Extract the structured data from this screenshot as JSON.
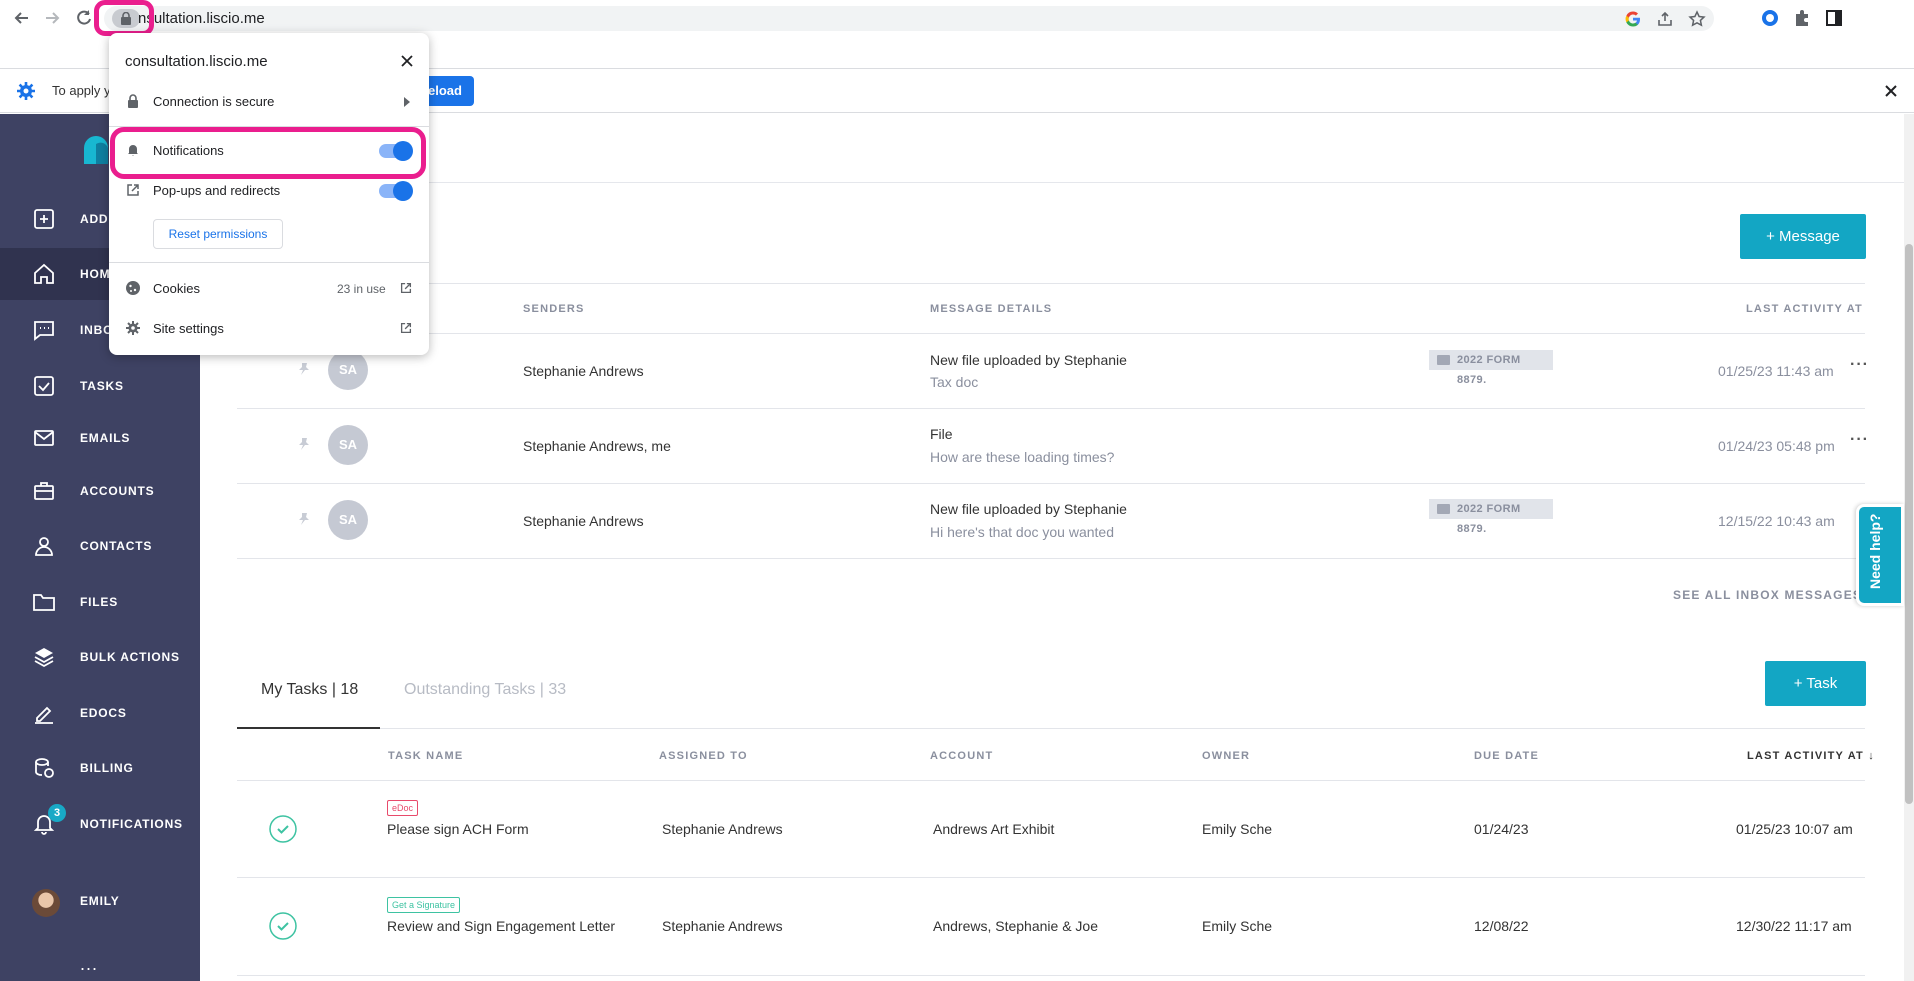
{
  "browser": {
    "url": "consultation.liscio.me",
    "url_visible": "nsultation.liscio.me"
  },
  "infobar": {
    "text": "To apply y",
    "reload_label": "eload"
  },
  "site_popup": {
    "domain": "consultation.liscio.me",
    "connection": "Connection is secure",
    "notifications": "Notifications",
    "notifications_on": true,
    "popups": "Pop-ups and redirects",
    "popups_on": true,
    "reset": "Reset permissions",
    "cookies": "Cookies",
    "cookies_count": "23 in use",
    "site_settings": "Site settings"
  },
  "sidebar": {
    "items": [
      {
        "label": "ADD",
        "icon": "plus-square-icon"
      },
      {
        "label": "HOME",
        "icon": "home-icon"
      },
      {
        "label": "INBOX",
        "icon": "chat-icon"
      },
      {
        "label": "TASKS",
        "icon": "checkbox-icon"
      },
      {
        "label": "EMAILS",
        "icon": "mail-icon"
      },
      {
        "label": "ACCOUNTS",
        "icon": "briefcase-icon"
      },
      {
        "label": "CONTACTS",
        "icon": "person-icon"
      },
      {
        "label": "FILES",
        "icon": "folder-icon"
      },
      {
        "label": "BULK ACTIONS",
        "icon": "layers-icon"
      },
      {
        "label": "EDOCS",
        "icon": "pen-icon"
      },
      {
        "label": "BILLING",
        "icon": "coins-icon"
      },
      {
        "label": "NOTIFICATIONS",
        "icon": "bell-icon",
        "badge": "3"
      },
      {
        "label": "EMILY",
        "icon": "avatar"
      }
    ],
    "more": "..."
  },
  "inbox": {
    "message_button": "+   Message",
    "headers": {
      "senders": "SENDERS",
      "details": "MESSAGE DETAILS",
      "last_activity": "LAST ACTIVITY AT"
    },
    "rows": [
      {
        "initials": "SA",
        "sender": "Stephanie Andrews",
        "title": "New file uploaded by Stephanie",
        "sub": "Tax doc",
        "tag": "2022 FORM 8879.",
        "date": "01/25/23 11:43 am"
      },
      {
        "initials": "SA",
        "sender": "Stephanie Andrews, me",
        "title": "File",
        "sub": "How are these loading times?",
        "tag": "",
        "date": "01/24/23 05:48 pm"
      },
      {
        "initials": "SA",
        "sender": "Stephanie Andrews",
        "title": "New file uploaded by Stephanie",
        "sub": "Hi here's that doc you wanted",
        "tag": "2022 FORM 8879.",
        "date": "12/15/22 10:43 am"
      }
    ],
    "see_all": "SEE ALL INBOX MESSAGES"
  },
  "tasks": {
    "tab_mine": "My Tasks | 18",
    "tab_outstanding": "Outstanding Tasks | 33",
    "task_button": "+   Task",
    "headers": {
      "name": "TASK NAME",
      "assigned": "ASSIGNED TO",
      "account": "ACCOUNT",
      "owner": "OWNER",
      "due": "DUE DATE",
      "last": "LAST ACTIVITY AT ↓"
    },
    "rows": [
      {
        "badge": "eDoc",
        "name": "Please sign ACH Form",
        "assigned": "Stephanie Andrews",
        "account": "Andrews Art Exhibit",
        "owner": "Emily Sche",
        "due": "01/24/23",
        "last": "01/25/23 10:07 am"
      },
      {
        "badge": "Get a Signature",
        "name": "Review and Sign Engagement Letter",
        "assigned": "Stephanie Andrews",
        "account": "Andrews, Stephanie & Joe",
        "owner": "Emily Sche",
        "due": "12/08/22",
        "last": "12/30/22 11:17 am"
      }
    ]
  },
  "help": {
    "label": "Need help?"
  },
  "colors": {
    "sidebar": "#3e4263",
    "accent": "#13a6c4",
    "highlight": "#ea1e8e",
    "chrome_blue": "#1a73e8"
  }
}
